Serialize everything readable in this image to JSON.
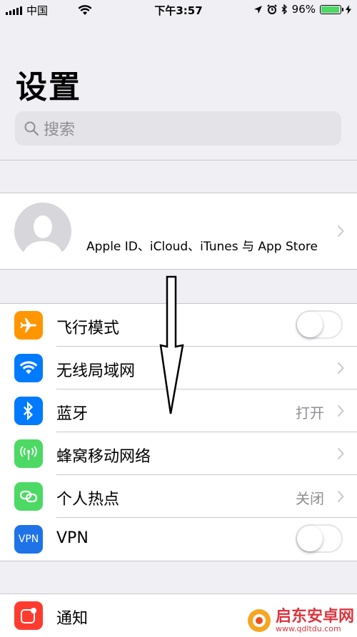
{
  "status_bar": {
    "carrier": "中国",
    "time": "下午3:57",
    "battery_percent": "96%",
    "battery_level": 0.96
  },
  "page_title": "设置",
  "search": {
    "placeholder": "搜索"
  },
  "profile": {
    "name": "",
    "subtitle": "Apple ID、iCloud、iTunes 与 App Store"
  },
  "rows_group1": [
    {
      "label": "飞行模式",
      "icon": "airplane-icon",
      "color": "#ff9500",
      "accessory": "toggle",
      "on": false
    },
    {
      "label": "无线局域网",
      "icon": "wifi-icon",
      "color": "#007aff",
      "accessory": "chevron",
      "value": ""
    },
    {
      "label": "蓝牙",
      "icon": "bluetooth-icon",
      "color": "#007aff",
      "accessory": "chevron",
      "value": "打开"
    },
    {
      "label": "蜂窝移动网络",
      "icon": "cellular-icon",
      "color": "#4cd964",
      "accessory": "chevron",
      "value": ""
    },
    {
      "label": "个人热点",
      "icon": "hotspot-icon",
      "color": "#4cd964",
      "accessory": "chevron",
      "value": "关闭"
    },
    {
      "label": "VPN",
      "icon": "vpn-icon",
      "icon_text": "VPN",
      "color": "#1e73e8",
      "accessory": "toggle",
      "on": false
    }
  ],
  "rows_group2": [
    {
      "label": "通知",
      "icon": "notifications-icon",
      "color": "#ff3b30"
    }
  ],
  "watermark": {
    "name": "启东安卓网",
    "url": "www.qdltdu.com"
  }
}
